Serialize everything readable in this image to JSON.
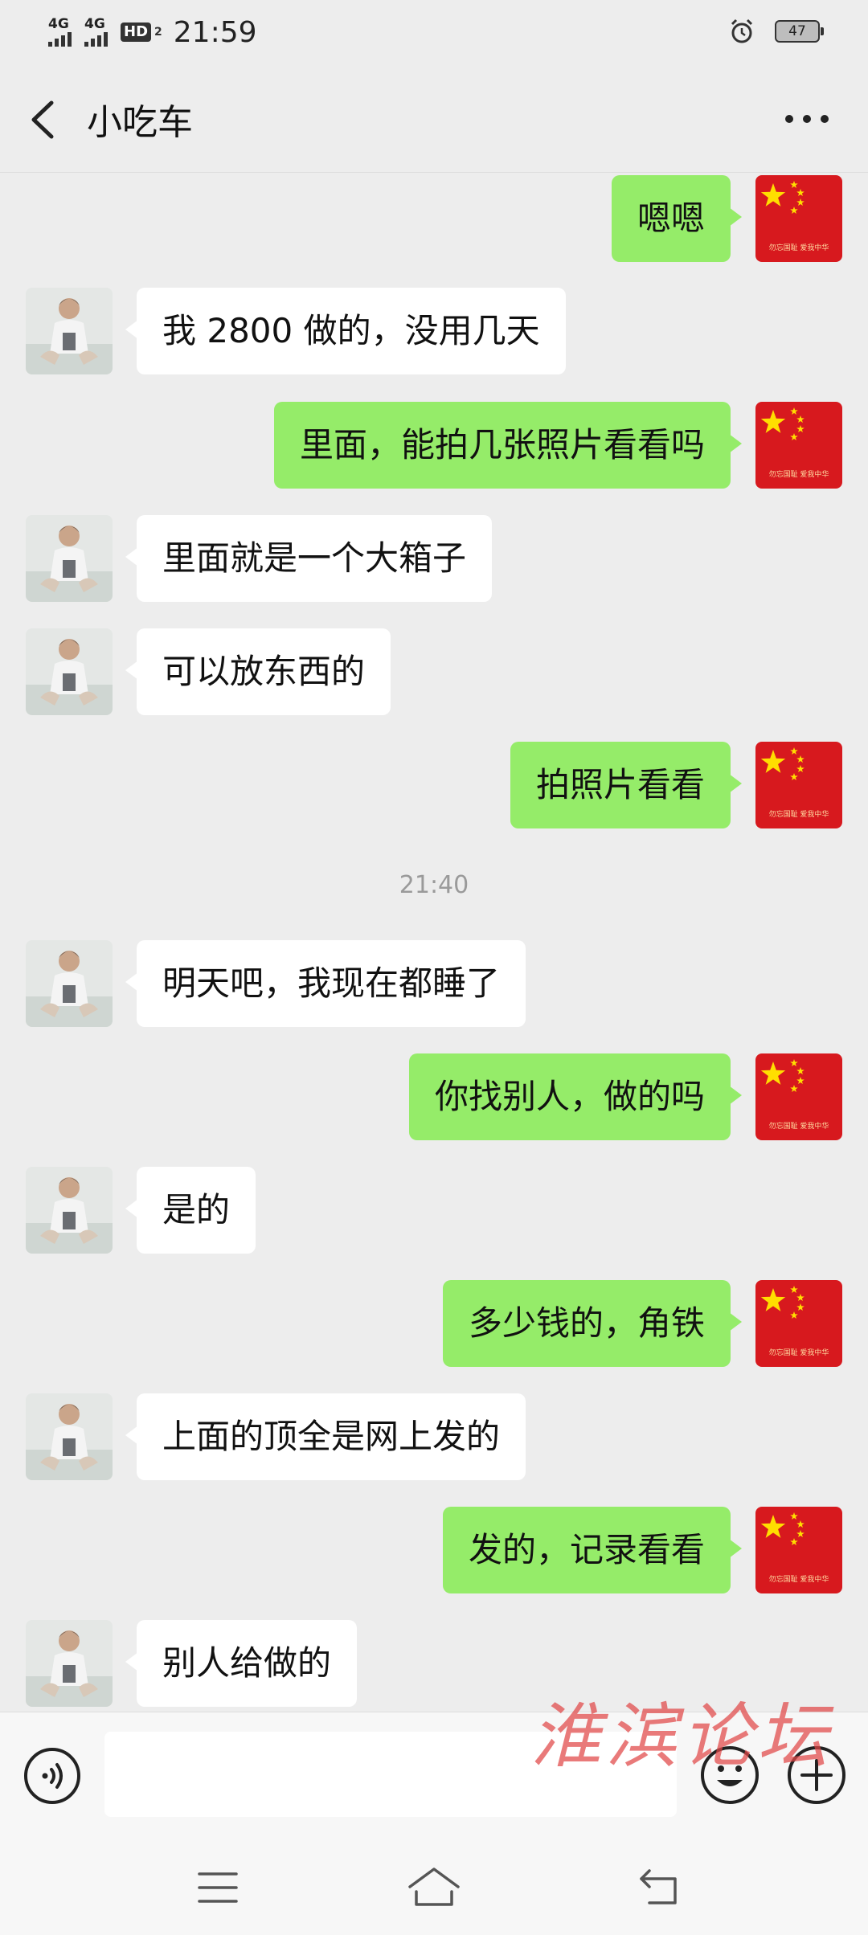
{
  "status_bar": {
    "signal1": "4G",
    "signal2": "4G",
    "hd": "HD",
    "hd_sub": "2",
    "time": "21:59",
    "battery": "47"
  },
  "header": {
    "title": "小吃车",
    "back_icon": "chevron-left-icon",
    "more_icon": "more-dots-icon"
  },
  "messages": [
    {
      "side": "self",
      "text": "嗯嗯"
    },
    {
      "side": "other",
      "text": "我 2800 做的，没用几天"
    },
    {
      "side": "self",
      "text": "里面，能拍几张照片看看吗"
    },
    {
      "side": "other",
      "text": "里面就是一个大箱子"
    },
    {
      "side": "other",
      "text": "可以放东西的"
    },
    {
      "side": "self",
      "text": "拍照片看看"
    },
    {
      "side": "other",
      "text": "明天吧，我现在都睡了"
    },
    {
      "side": "self",
      "text": "你找别人，做的吗"
    },
    {
      "side": "other",
      "text": "是的"
    },
    {
      "side": "self",
      "text": "多少钱的，角铁"
    },
    {
      "side": "other",
      "text": "上面的顶全是网上发的"
    },
    {
      "side": "self",
      "text": "发的，记录看看"
    },
    {
      "side": "other",
      "text": "别人给做的"
    }
  ],
  "timestamp": "21:40",
  "input_bar": {
    "voice_icon": "voice-icon",
    "emoji_icon": "emoji-icon",
    "plus_icon": "plus-icon"
  },
  "watermark": "淮滨论坛",
  "avatar_self_caption": "勿忘国耻 爱我中华",
  "colors": {
    "self_bubble": "#95ec69",
    "other_bubble": "#ffffff",
    "background": "#ededed",
    "flag_red": "#d7191e",
    "flag_star": "#ffde00"
  }
}
